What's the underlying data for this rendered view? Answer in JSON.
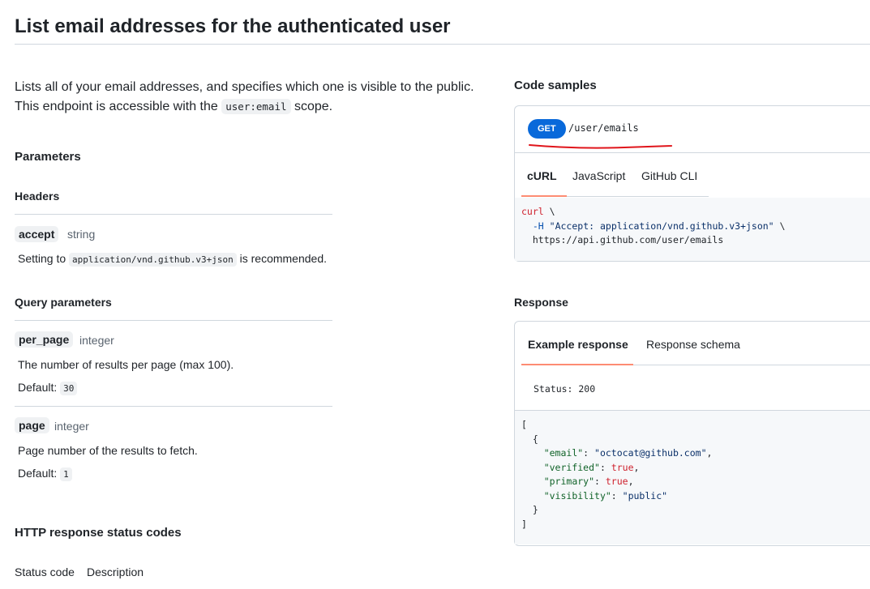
{
  "page": {
    "title": "List email addresses for the authenticated user",
    "intro_line1": "Lists all of your email addresses, and specifies which one is visible to the public.",
    "intro_line2_prefix": "This endpoint is accessible with the ",
    "intro_scope": "user:email",
    "intro_line2_suffix": " scope."
  },
  "parameters": {
    "heading": "Parameters",
    "headers_heading": "Headers",
    "accept": {
      "name": "accept",
      "type": "string",
      "desc_prefix": "Setting to ",
      "desc_code": "application/vnd.github.v3+json",
      "desc_suffix": " is recommended."
    },
    "query_heading": "Query parameters",
    "per_page": {
      "name": "per_page",
      "type": "integer",
      "desc": "The number of results per page (max 100).",
      "default_label": "Default:",
      "default_value": "30"
    },
    "page": {
      "name": "page",
      "type": "integer",
      "desc": "Page number of the results to fetch.",
      "default_label": "Default:",
      "default_value": "1"
    }
  },
  "status_codes": {
    "heading": "HTTP response status codes",
    "col_code": "Status code",
    "col_desc": "Description"
  },
  "code_samples": {
    "heading": "Code samples",
    "method": "GET",
    "path": "/user/emails",
    "tabs": [
      "cURL",
      "JavaScript",
      "GitHub CLI"
    ],
    "active_tab": "cURL",
    "curl_cmd": "curl",
    "curl_line1_rest": " \\",
    "curl_line2_flag": "-H",
    "curl_line2_value": "\"Accept: application/vnd.github.v3+json\"",
    "curl_line2_rest": " \\",
    "curl_line3": "https://api.github.com/user/emails",
    "annotation_color": "#e0151b"
  },
  "response": {
    "heading": "Response",
    "tabs": [
      "Example response",
      "Response schema"
    ],
    "active_tab": "Example response",
    "status_text": "Status: 200",
    "json": {
      "email_key": "\"email\"",
      "email_val": "\"octocat@github.com\"",
      "verified_key": "\"verified\"",
      "verified_val": "true",
      "primary_key": "\"primary\"",
      "primary_val": "true",
      "visibility_key": "\"visibility\"",
      "visibility_val": "\"public\""
    }
  },
  "colors": {
    "accent": "#0969da",
    "tab_underline": "#fd8c73",
    "border": "#d0d7de"
  }
}
